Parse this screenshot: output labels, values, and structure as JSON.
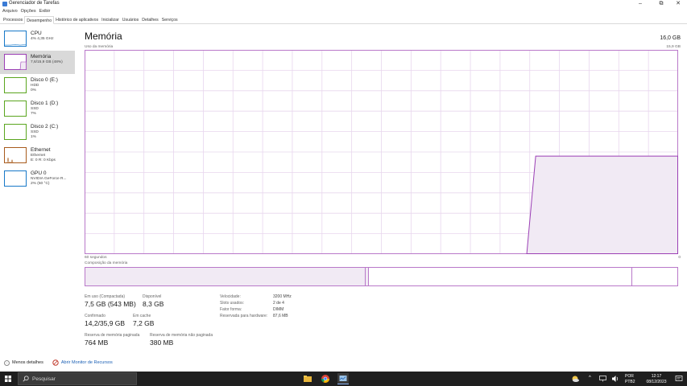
{
  "window": {
    "title": "Gerenciador de Tarefas",
    "controls": {
      "minimize": "–",
      "maximize": "⧉",
      "close": "✕"
    }
  },
  "menu": [
    "Arquivo",
    "Opções",
    "Exibir"
  ],
  "tabs": [
    "Processos",
    "Desempenho",
    "Histórico de aplicativos",
    "Inicializar",
    "Usuários",
    "Detalhes",
    "Serviços"
  ],
  "active_tab": "Desempenho",
  "sidebar": [
    {
      "name": "CPU",
      "line1": "4% 4,35 GHz",
      "line2": "",
      "color": "#1778c8"
    },
    {
      "name": "Memória",
      "line1": "7,6/15,9 GB (48%)",
      "line2": "",
      "color": "#9b3fb5"
    },
    {
      "name": "Disco 0 (E:)",
      "line1": "HDD",
      "line2": "0%",
      "color": "#5aa51e"
    },
    {
      "name": "Disco 1 (D:)",
      "line1": "SSD",
      "line2": "7%",
      "color": "#5aa51e"
    },
    {
      "name": "Disco 2 (C:)",
      "line1": "SSD",
      "line2": "1%",
      "color": "#5aa51e"
    },
    {
      "name": "Ethernet",
      "line1": "Ethernet",
      "line2": "E: 0 R: 0 Kbps",
      "color": "#a85b1c"
    },
    {
      "name": "GPU 0",
      "line1": "NVIDIA GeForce R...",
      "line2": "2% (50 °C)",
      "color": "#1778c8"
    }
  ],
  "memory": {
    "title": "Memória",
    "total": "16,0 GB",
    "graph_label": "Uso da memória",
    "graph_max": "15,9 GB",
    "graph_x_left": "60 segundos",
    "graph_x_right": "0",
    "composition_label": "Composição da memória",
    "usage_fraction_recent": 0.48,
    "stats": {
      "in_use_label": "Em uso (Compactada)",
      "in_use_value": "7,5 GB (543 MB)",
      "available_label": "Disponível",
      "available_value": "8,3 GB",
      "committed_label": "Confirmado",
      "committed_value": "14,2/35,9 GB",
      "cached_label": "Em cache",
      "cached_value": "7,2 GB",
      "paged_label": "Reserva de memória paginada",
      "paged_value": "764 MB",
      "nonpaged_label": "Reserva de memória não paginada",
      "nonpaged_value": "380 MB"
    },
    "details": [
      {
        "key": "Velocidade:",
        "value": "3200 MHz"
      },
      {
        "key": "Slots usados:",
        "value": "2 de 4"
      },
      {
        "key": "Fator forma:",
        "value": "DIMM"
      },
      {
        "key": "Reservada para hardware:",
        "value": "87,6 MB"
      }
    ]
  },
  "footer": {
    "fewer_details": "Menos detalhes",
    "resource_monitor": "Abrir Monitor de Recursos"
  },
  "taskbar": {
    "search_placeholder": "Pesquisar",
    "language": "POR",
    "layout": "PTB2",
    "time": "12:17",
    "date": "08/12/2023"
  },
  "colors": {
    "memory_accent": "#9b3fb5",
    "memory_fill": "#f1eaf4",
    "grid": "#e8d6ee"
  }
}
